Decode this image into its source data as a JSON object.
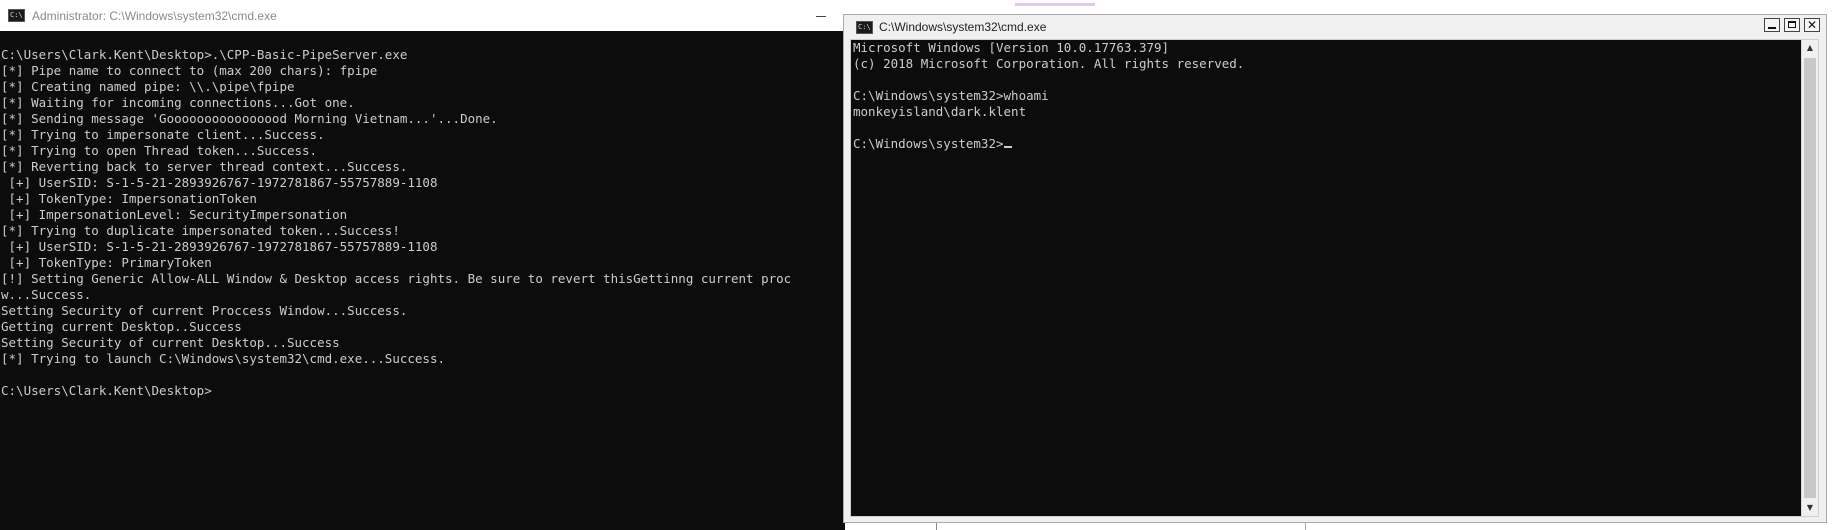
{
  "background_window": {
    "title": "Administrator: C:\\Windows\\system32\\cmd.exe",
    "icon": "cmd-icon",
    "console_text": "C:\\Users\\Clark.Kent\\Desktop>.\\CPP-Basic-PipeServer.exe\n[*] Pipe name to connect to (max 200 chars): fpipe\n[*] Creating named pipe: \\\\.\\pipe\\fpipe\n[*] Waiting for incoming connections...Got one.\n[*] Sending message 'Goooooooooooooood Morning Vietnam...'...Done.\n[*] Trying to impersonate client...Success.\n[*] Trying to open Thread token...Success.\n[*] Reverting back to server thread context...Success.\n [+] UserSID: S-1-5-21-2893926767-1972781867-55757889-1108\n [+] TokenType: ImpersonationToken\n [+] ImpersonationLevel: SecurityImpersonation\n[*] Trying to duplicate impersonated token...Success!\n [+] UserSID: S-1-5-21-2893926767-1972781867-55757889-1108\n [+] TokenType: PrimaryToken\n[!] Setting Generic Allow-ALL Window & Desktop access rights. Be sure to revert thisGettinng current proc\nw...Success.\nSetting Security of current Proccess Window...Success.\nGetting current Desktop..Success\nSetting Security of current Desktop...Success\n[*] Trying to launch C:\\Windows\\system32\\cmd.exe...Success.\n\nC:\\Users\\Clark.Kent\\Desktop>"
  },
  "foreground_window": {
    "title": "C:\\Windows\\system32\\cmd.exe",
    "icon": "cmd-icon",
    "console_text": "Microsoft Windows [Version 10.0.17763.379]\n(c) 2018 Microsoft Corporation. All rights reserved.\n\nC:\\Windows\\system32>whoami\nmonkeyisland\\dark.klent\n\nC:\\Windows\\system32>",
    "buttons": {
      "close_glyph": "✕"
    }
  },
  "colors": {
    "console_bg": "#0c0c0c",
    "console_fg": "#cccccc",
    "titlebar_inactive_text": "#8a8a8a"
  }
}
